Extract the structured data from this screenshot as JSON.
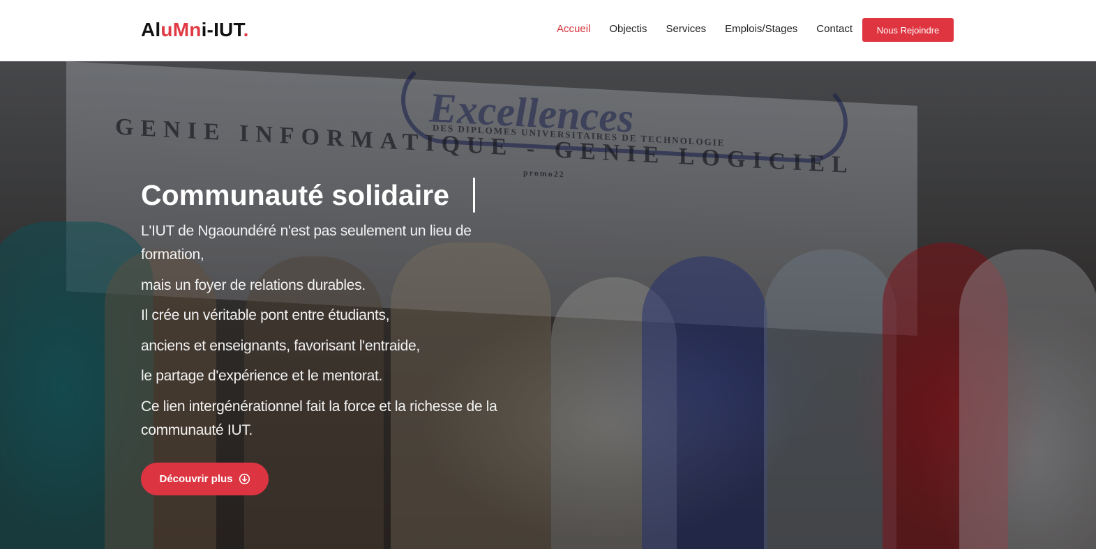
{
  "header": {
    "logo": {
      "parts": [
        "Al",
        "u",
        "M",
        "n",
        "i-IUT",
        "."
      ]
    },
    "nav": [
      {
        "label": "Accueil",
        "active": true
      },
      {
        "label": "Objectis",
        "active": false
      },
      {
        "label": "Services",
        "active": false
      },
      {
        "label": "Emplois/Stages",
        "active": false
      },
      {
        "label": "Contact",
        "active": false
      }
    ],
    "join_button": "Nous Rejoindre"
  },
  "hero": {
    "title": "Communauté solidaire",
    "paragraphs": [
      "L'IUT de Ngaoundéré n'est pas seulement un lieu de formation,",
      "mais un foyer de relations durables.",
      "Il crée un véritable pont entre étudiants,",
      "anciens et enseignants, favorisant l'entraide,",
      "le partage d'expérience et le mentorat.",
      "Ce lien intergénérationnel fait la force et la richesse de la communauté IUT."
    ],
    "cta_label": "Découvrir plus",
    "cta_icon": "arrow-down-circle-icon",
    "background": {
      "banner_lines": [
        "Excellences",
        "DES DIPLOMES UNIVERSITAIRES DE TECHNOLOGIE",
        "GENIE INFORMATIQUE - GENIE LOGICIEL",
        "promo22"
      ]
    }
  },
  "colors": {
    "accent": "#df3540",
    "nav_active": "#d9343f",
    "text_dark": "#222222"
  }
}
